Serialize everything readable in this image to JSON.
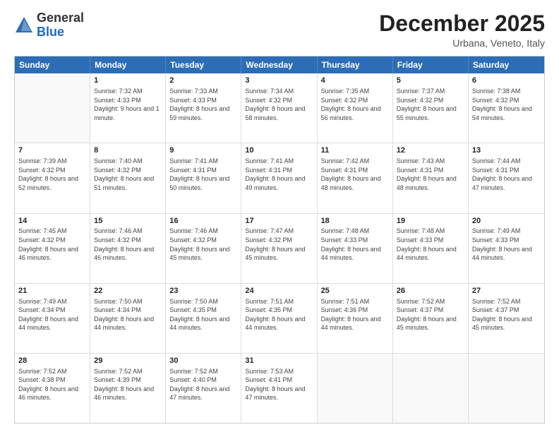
{
  "header": {
    "logo_general": "General",
    "logo_blue": "Blue",
    "month_title": "December 2025",
    "location": "Urbana, Veneto, Italy"
  },
  "weekdays": [
    "Sunday",
    "Monday",
    "Tuesday",
    "Wednesday",
    "Thursday",
    "Friday",
    "Saturday"
  ],
  "rows": [
    [
      {
        "day": "",
        "empty": true
      },
      {
        "day": "1",
        "sunrise": "Sunrise: 7:32 AM",
        "sunset": "Sunset: 4:33 PM",
        "daylight": "Daylight: 9 hours and 1 minute."
      },
      {
        "day": "2",
        "sunrise": "Sunrise: 7:33 AM",
        "sunset": "Sunset: 4:33 PM",
        "daylight": "Daylight: 8 hours and 59 minutes."
      },
      {
        "day": "3",
        "sunrise": "Sunrise: 7:34 AM",
        "sunset": "Sunset: 4:32 PM",
        "daylight": "Daylight: 8 hours and 58 minutes."
      },
      {
        "day": "4",
        "sunrise": "Sunrise: 7:35 AM",
        "sunset": "Sunset: 4:32 PM",
        "daylight": "Daylight: 8 hours and 56 minutes."
      },
      {
        "day": "5",
        "sunrise": "Sunrise: 7:37 AM",
        "sunset": "Sunset: 4:32 PM",
        "daylight": "Daylight: 8 hours and 55 minutes."
      },
      {
        "day": "6",
        "sunrise": "Sunrise: 7:38 AM",
        "sunset": "Sunset: 4:32 PM",
        "daylight": "Daylight: 8 hours and 54 minutes."
      }
    ],
    [
      {
        "day": "7",
        "sunrise": "Sunrise: 7:39 AM",
        "sunset": "Sunset: 4:32 PM",
        "daylight": "Daylight: 8 hours and 52 minutes."
      },
      {
        "day": "8",
        "sunrise": "Sunrise: 7:40 AM",
        "sunset": "Sunset: 4:32 PM",
        "daylight": "Daylight: 8 hours and 51 minutes."
      },
      {
        "day": "9",
        "sunrise": "Sunrise: 7:41 AM",
        "sunset": "Sunset: 4:31 PM",
        "daylight": "Daylight: 8 hours and 50 minutes."
      },
      {
        "day": "10",
        "sunrise": "Sunrise: 7:41 AM",
        "sunset": "Sunset: 4:31 PM",
        "daylight": "Daylight: 8 hours and 49 minutes."
      },
      {
        "day": "11",
        "sunrise": "Sunrise: 7:42 AM",
        "sunset": "Sunset: 4:31 PM",
        "daylight": "Daylight: 8 hours and 48 minutes."
      },
      {
        "day": "12",
        "sunrise": "Sunrise: 7:43 AM",
        "sunset": "Sunset: 4:31 PM",
        "daylight": "Daylight: 8 hours and 48 minutes."
      },
      {
        "day": "13",
        "sunrise": "Sunrise: 7:44 AM",
        "sunset": "Sunset: 4:31 PM",
        "daylight": "Daylight: 8 hours and 47 minutes."
      }
    ],
    [
      {
        "day": "14",
        "sunrise": "Sunrise: 7:45 AM",
        "sunset": "Sunset: 4:32 PM",
        "daylight": "Daylight: 8 hours and 46 minutes."
      },
      {
        "day": "15",
        "sunrise": "Sunrise: 7:46 AM",
        "sunset": "Sunset: 4:32 PM",
        "daylight": "Daylight: 8 hours and 46 minutes."
      },
      {
        "day": "16",
        "sunrise": "Sunrise: 7:46 AM",
        "sunset": "Sunset: 4:32 PM",
        "daylight": "Daylight: 8 hours and 45 minutes."
      },
      {
        "day": "17",
        "sunrise": "Sunrise: 7:47 AM",
        "sunset": "Sunset: 4:32 PM",
        "daylight": "Daylight: 8 hours and 45 minutes."
      },
      {
        "day": "18",
        "sunrise": "Sunrise: 7:48 AM",
        "sunset": "Sunset: 4:33 PM",
        "daylight": "Daylight: 8 hours and 44 minutes."
      },
      {
        "day": "19",
        "sunrise": "Sunrise: 7:48 AM",
        "sunset": "Sunset: 4:33 PM",
        "daylight": "Daylight: 8 hours and 44 minutes."
      },
      {
        "day": "20",
        "sunrise": "Sunrise: 7:49 AM",
        "sunset": "Sunset: 4:33 PM",
        "daylight": "Daylight: 8 hours and 44 minutes."
      }
    ],
    [
      {
        "day": "21",
        "sunrise": "Sunrise: 7:49 AM",
        "sunset": "Sunset: 4:34 PM",
        "daylight": "Daylight: 8 hours and 44 minutes."
      },
      {
        "day": "22",
        "sunrise": "Sunrise: 7:50 AM",
        "sunset": "Sunset: 4:34 PM",
        "daylight": "Daylight: 8 hours and 44 minutes."
      },
      {
        "day": "23",
        "sunrise": "Sunrise: 7:50 AM",
        "sunset": "Sunset: 4:35 PM",
        "daylight": "Daylight: 8 hours and 44 minutes."
      },
      {
        "day": "24",
        "sunrise": "Sunrise: 7:51 AM",
        "sunset": "Sunset: 4:35 PM",
        "daylight": "Daylight: 8 hours and 44 minutes."
      },
      {
        "day": "25",
        "sunrise": "Sunrise: 7:51 AM",
        "sunset": "Sunset: 4:36 PM",
        "daylight": "Daylight: 8 hours and 44 minutes."
      },
      {
        "day": "26",
        "sunrise": "Sunrise: 7:52 AM",
        "sunset": "Sunset: 4:37 PM",
        "daylight": "Daylight: 8 hours and 45 minutes."
      },
      {
        "day": "27",
        "sunrise": "Sunrise: 7:52 AM",
        "sunset": "Sunset: 4:37 PM",
        "daylight": "Daylight: 8 hours and 45 minutes."
      }
    ],
    [
      {
        "day": "28",
        "sunrise": "Sunrise: 7:52 AM",
        "sunset": "Sunset: 4:38 PM",
        "daylight": "Daylight: 8 hours and 46 minutes."
      },
      {
        "day": "29",
        "sunrise": "Sunrise: 7:52 AM",
        "sunset": "Sunset: 4:39 PM",
        "daylight": "Daylight: 8 hours and 46 minutes."
      },
      {
        "day": "30",
        "sunrise": "Sunrise: 7:52 AM",
        "sunset": "Sunset: 4:40 PM",
        "daylight": "Daylight: 8 hours and 47 minutes."
      },
      {
        "day": "31",
        "sunrise": "Sunrise: 7:53 AM",
        "sunset": "Sunset: 4:41 PM",
        "daylight": "Daylight: 8 hours and 47 minutes."
      },
      {
        "day": "",
        "empty": true
      },
      {
        "day": "",
        "empty": true
      },
      {
        "day": "",
        "empty": true
      }
    ]
  ]
}
